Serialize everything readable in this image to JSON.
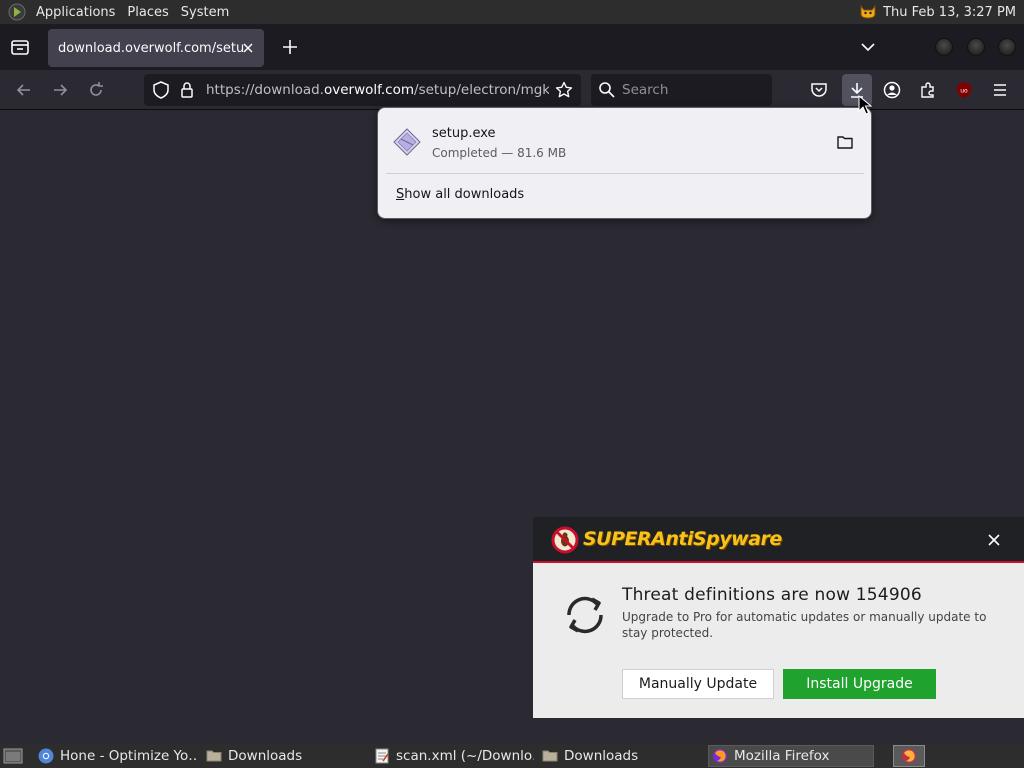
{
  "top_panel": {
    "menus": [
      "Applications",
      "Places",
      "System"
    ],
    "clock": "Thu Feb 13,  3:27 PM"
  },
  "browser": {
    "tab": {
      "title": "download.overwolf.com/setup/electron/mgkaborgjdcfdcadokdhonkmdeelfhhlbmdpg"
    },
    "urlbar": {
      "prefix": "https://download.",
      "host": "overwolf.com",
      "path": "/setup/electron/mgkaborgjdcfdcadokdhonkmdeelfhhlbmdpg"
    },
    "search": {
      "placeholder": "Search"
    }
  },
  "downloads_panel": {
    "items": [
      {
        "name": "setup.exe",
        "status": "Completed — 81.6 MB"
      }
    ],
    "show_all_prefix": "S",
    "show_all_rest": "how all downloads"
  },
  "sas_notification": {
    "brand": "SUPERAntiSpyware",
    "title": "Threat definitions are now 154906",
    "message": "Upgrade to Pro for automatic updates or manually update to stay protected.",
    "manual_button": "Manually Update",
    "install_button": "Install Upgrade",
    "colors": {
      "install": "#1fa22e",
      "brand": "#f7c319",
      "accent": "#c8102e"
    }
  },
  "taskbar": {
    "items": [
      {
        "label": "Hone - Optimize Yo…",
        "icon": "chromium-icon"
      },
      {
        "label": "Downloads",
        "icon": "folder-icon"
      },
      {
        "label": "scan.xml (~/Downlo…",
        "icon": "text-editor-icon"
      },
      {
        "label": "Downloads",
        "icon": "folder-icon"
      },
      {
        "label": "Mozilla Firefox",
        "icon": "firefox-icon"
      }
    ]
  }
}
